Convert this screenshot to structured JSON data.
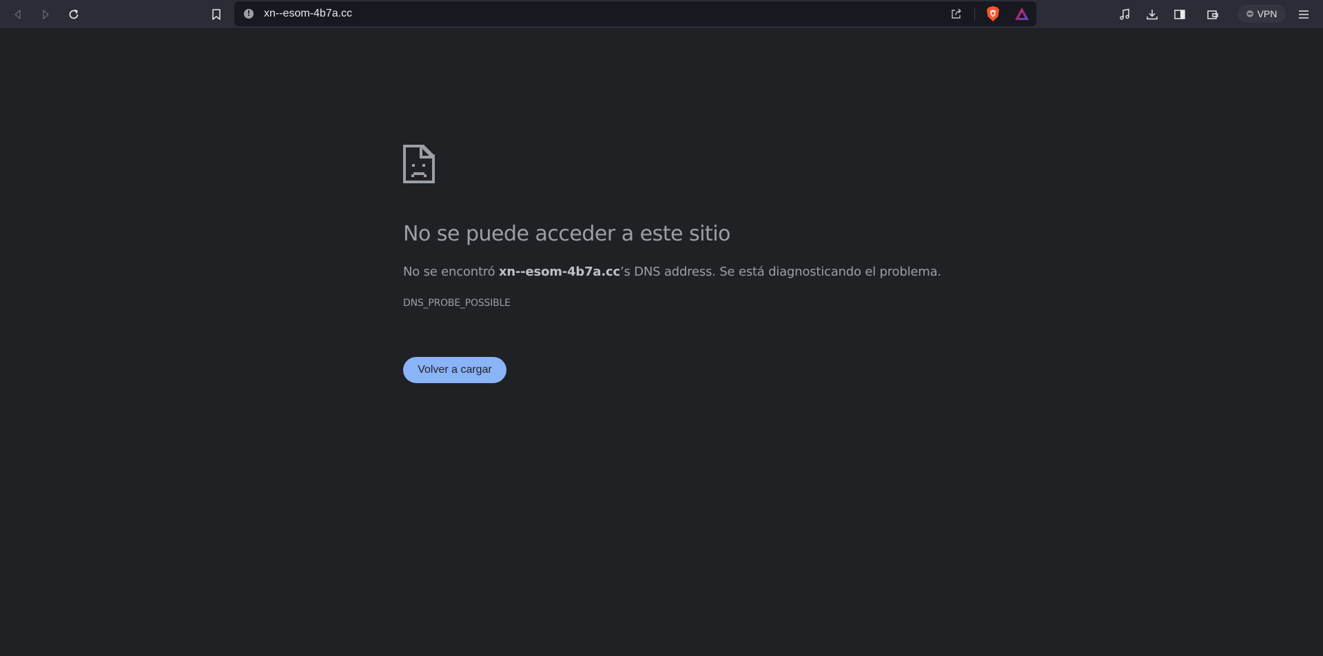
{
  "browser": {
    "url": "xn--esom-4b7a.cc",
    "vpn_label": "VPN",
    "icons": {
      "back": "back-arrow-icon",
      "forward": "forward-arrow-icon",
      "reload": "reload-icon",
      "bookmark": "bookmark-icon",
      "site_info": "info-icon",
      "share": "share-icon",
      "shields": "brave-shields-icon",
      "rewards": "brave-rewards-icon",
      "playlist": "music-note-icon",
      "downloads": "download-icon",
      "sidebar": "sidebar-icon",
      "wallet": "wallet-icon",
      "menu": "hamburger-menu-icon"
    },
    "colors": {
      "toolbar_bg": "#2b2d36",
      "urlbar_bg": "#181920",
      "shields_orange": "#fb542b"
    }
  },
  "error_page": {
    "icon": "sad-document-icon",
    "title": "No se puede acceder a este sitio",
    "desc_prefix": "No se encontró ",
    "desc_host": "xn--esom-4b7a.cc",
    "desc_suffix": "’s DNS address. Se está diagnosticando el problema.",
    "error_code": "DNS_PROBE_POSSIBLE",
    "reload_button": "Volver a cargar",
    "colors": {
      "page_bg": "#202124",
      "text": "#9aa0a6",
      "button_bg": "#8ab4f8"
    }
  }
}
